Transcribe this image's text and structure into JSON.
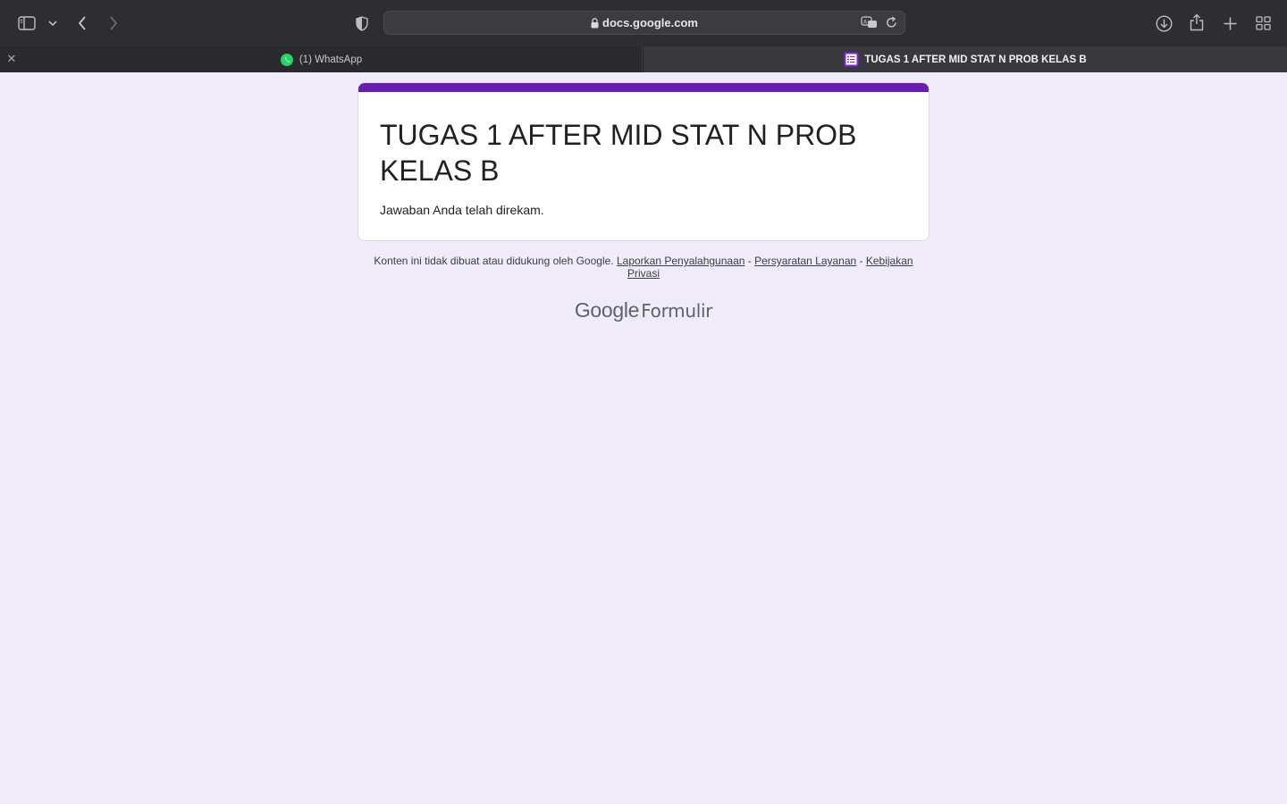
{
  "browser": {
    "address": "docs.google.com",
    "tabs": [
      {
        "label": "(1) WhatsApp"
      },
      {
        "label": "TUGAS 1 AFTER MID STAT N PROB KELAS B"
      }
    ]
  },
  "form": {
    "title": "TUGAS 1 AFTER MID STAT N PROB KELAS B",
    "message": "Jawaban Anda telah direkam.",
    "accent_color": "#6a1bb1"
  },
  "footer": {
    "disclaimer": "Konten ini tidak dibuat atau didukung oleh Google.",
    "link_abuse": "Laporkan Penyalahgunaan",
    "sep1": " - ",
    "link_terms": "Persyaratan Layanan",
    "sep2": " - ",
    "link_privacy": "Kebijakan Privasi"
  },
  "logo": {
    "google": "Google",
    "product": "Formulir"
  }
}
